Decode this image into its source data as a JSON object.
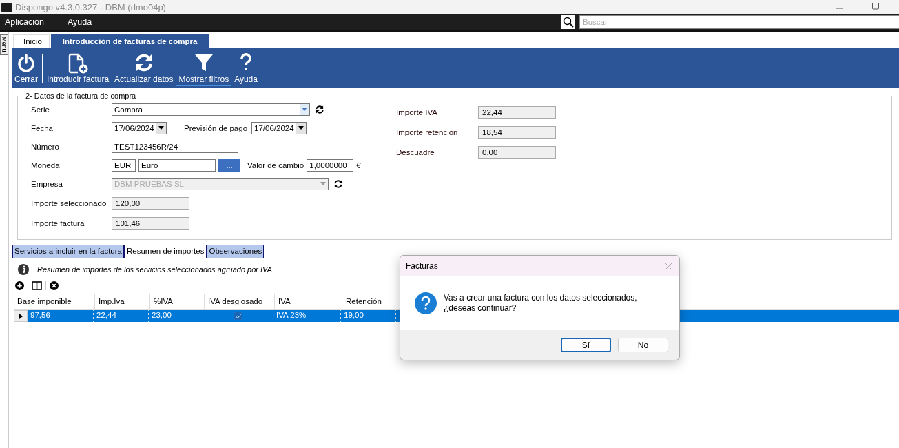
{
  "window": {
    "title": "Dispongo v4.3.0.327 - DBM (dmo04p)"
  },
  "menu": [
    {
      "label": "Aplicación"
    },
    {
      "label": "Ayuda"
    }
  ],
  "search": {
    "placeholder": "Buscar"
  },
  "side_tab": {
    "label": "Menu"
  },
  "tabs": [
    {
      "label": "Inicio",
      "selected": false
    },
    {
      "label": "Introducción de facturas de compra",
      "selected": true
    }
  ],
  "toolbar": [
    {
      "kind": "power",
      "label": "Cerrar",
      "highlighted": false
    },
    {
      "kind": "new-document",
      "label": "Introducir factura",
      "highlighted": false
    },
    {
      "kind": "refresh",
      "label": "Actualizar datos",
      "highlighted": false
    },
    {
      "kind": "filter",
      "label": "Mostrar filtros",
      "highlighted": true
    },
    {
      "kind": "help",
      "label": "Ayuda",
      "highlighted": false
    }
  ],
  "form": {
    "title": "2- Datos de la factura de compra",
    "serie": {
      "label": "Serie",
      "value": "Compra"
    },
    "fecha": {
      "label": "Fecha",
      "value": "17/06/2024"
    },
    "prevision": {
      "label": "Previsión de pago",
      "value": "17/06/2024"
    },
    "numero": {
      "label": "Número",
      "value": "TEST123456R/24"
    },
    "moneda": {
      "label": "Moneda",
      "code": "EUR",
      "name": "Euro",
      "button": "...",
      "rate_label": "Valor de cambio",
      "rate": "1,0000000",
      "symbol": "€"
    },
    "empresa": {
      "label": "Empresa",
      "value": "DBM PRUEBAS SL",
      "disabled": true
    },
    "importe_seleccionado": {
      "label": "Importe seleccionado",
      "value": "120,00"
    },
    "importe_factura": {
      "label": "Importe factura",
      "value": "101,46"
    },
    "summary": [
      {
        "label": "Importe IVA",
        "value": "22,44"
      },
      {
        "label": "Importe retención",
        "value": "18,54"
      },
      {
        "label": "Descuadre",
        "value": "0,00"
      }
    ]
  },
  "detail_tabs": [
    {
      "label": "Servicios a incluir en la factura",
      "selected": false
    },
    {
      "label": "Resumen de importes",
      "selected": true
    },
    {
      "label": "Observaciones",
      "selected": false
    }
  ],
  "info": "Resumen de importes de los servicios seleccionados agruado por IVA",
  "table": {
    "columns": [
      "Base imponible",
      "Imp.Iva",
      "%IVA",
      "IVA desglosado",
      "IVA",
      "Retención"
    ],
    "rows": [
      {
        "selected": true,
        "base": "97,56",
        "imp_iva": "22,44",
        "pct_iva": "23,00",
        "desglosado": true,
        "iva": "IVA 23%",
        "retencion": "19,00"
      }
    ]
  },
  "dialog": {
    "title": "Facturas",
    "message": "Vas a crear una factura con los datos seleccionados, ¿deseas continuar?",
    "buttons": [
      {
        "label": "Sí",
        "selected": true
      },
      {
        "label": "No",
        "selected": false
      }
    ]
  }
}
